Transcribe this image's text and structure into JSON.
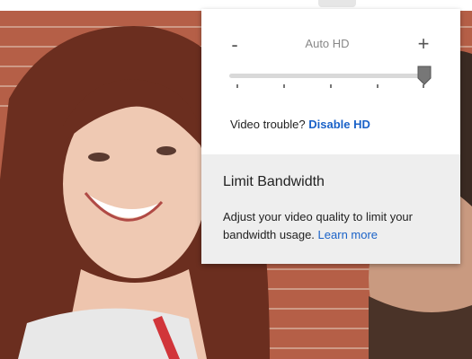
{
  "quality": {
    "minus_label": "-",
    "plus_label": "+",
    "current_label": "Auto HD",
    "level": 1.0,
    "tick_count": 5
  },
  "trouble": {
    "prefix": "Video trouble?",
    "link": "Disable HD"
  },
  "bandwidth": {
    "title": "Limit Bandwidth",
    "description": "Adjust your video quality to limit your bandwidth usage.",
    "link": "Learn more"
  },
  "colors": {
    "link": "#1a62c8",
    "panel_bg": "#ffffff",
    "section_bg": "#eeeeee"
  },
  "icons": {
    "slider_thumb": "slider-thumb-icon"
  }
}
